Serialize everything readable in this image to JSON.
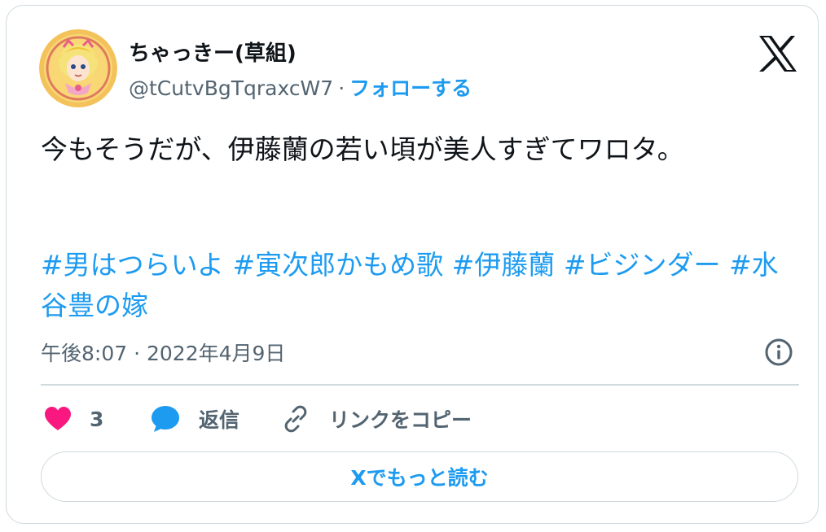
{
  "author": {
    "display_name": "ちゃっきー(草組)",
    "handle": "@tCutvBgTqraxcW7",
    "separator": "·",
    "follow_label": "フォローする",
    "avatar_icon": "character-avatar-icon"
  },
  "tweet": {
    "text": "今もそうだが、伊藤蘭の若い頃が美人すぎてワロタ。",
    "hashtags": [
      "#男はつらいよ",
      "#寅次郎かもめ歌",
      "#伊藤蘭",
      "#ビジンダー",
      "#水谷豊の嫁"
    ],
    "timestamp": "午後8:07 · 2022年4月9日"
  },
  "actions": {
    "like_count": "3",
    "reply_label": "返信",
    "copy_link_label": "リンクをコピー",
    "read_more_label": "Xでもっと読む"
  },
  "colors": {
    "accent": "#1d9bf0",
    "like": "#f91880",
    "text": "#0f1419",
    "muted": "#536471",
    "border": "#cfd9de"
  },
  "icons": [
    "x-logo-icon",
    "info-icon",
    "heart-icon",
    "reply-bubble-icon",
    "link-icon"
  ]
}
